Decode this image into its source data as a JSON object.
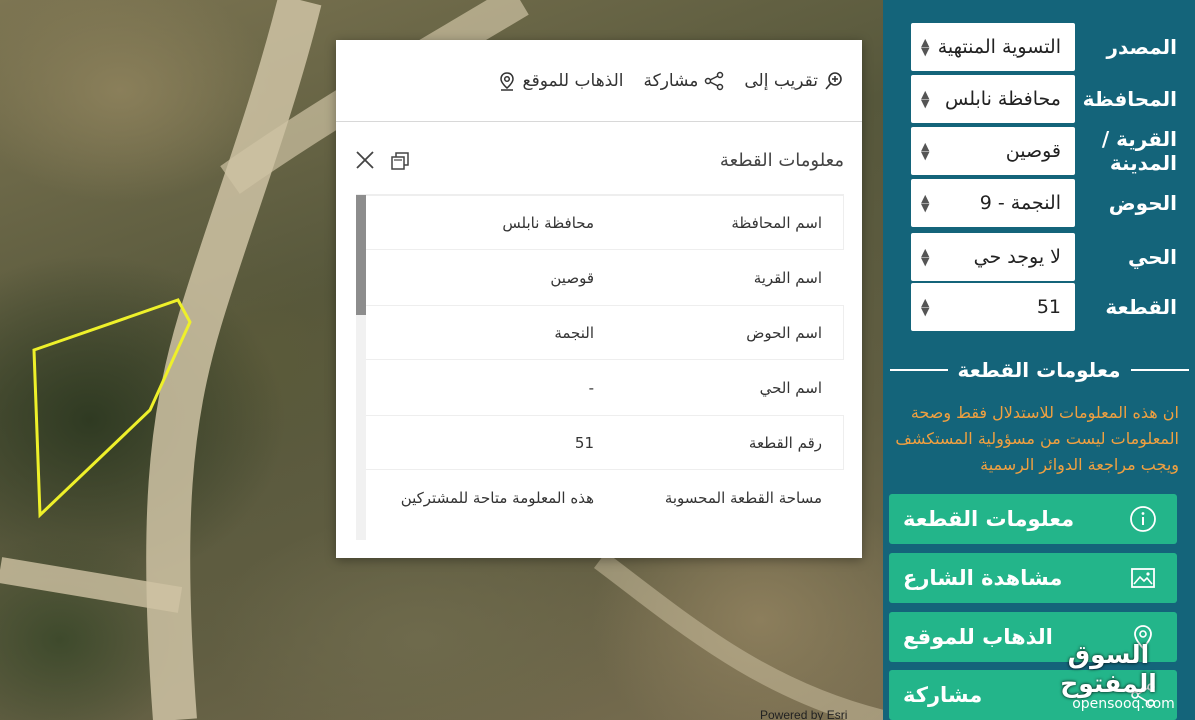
{
  "map": {
    "credit": "Powered by Esri"
  },
  "popup": {
    "actions": {
      "zoom_to": "تقريب إلى",
      "share": "مشاركة",
      "go_to_location": "الذهاب للموقع"
    },
    "title": "معلومات القطعة",
    "rows": [
      {
        "key": "اسم المحافظة",
        "value": "محافظة نابلس"
      },
      {
        "key": "اسم القرية",
        "value": "قوصين"
      },
      {
        "key": "اسم الحوض",
        "value": "النجمة"
      },
      {
        "key": "اسم الحي",
        "value": "-"
      },
      {
        "key": "رقم القطعة",
        "value": "51"
      },
      {
        "key": "مساحة القطعة المحسوبة",
        "value": "هذه المعلومة متاحة للمشتركين"
      }
    ]
  },
  "sidebar": {
    "fields": [
      {
        "label": "المصدر",
        "value": "التسوية المنتهية"
      },
      {
        "label": "المحافظة",
        "value": "محافظة نابلس"
      },
      {
        "label": "القرية / المدينة",
        "value": "قوصين"
      },
      {
        "label": "الحوض",
        "value": "النجمة - 9"
      },
      {
        "label": "الحي",
        "value": "لا يوجد حي"
      },
      {
        "label": "القطعة",
        "value": "51"
      }
    ],
    "section_title": "معلومات القطعة",
    "disclaimer": "ان هذه المعلومات للاستدلال فقط وصحة المعلومات ليست من مسؤولية المستكشف ويجب مراجعة الدوائر الرسمية",
    "buttons": {
      "parcel_info": "معلومات القطعة",
      "street_view": "مشاهدة الشارع",
      "go_to_location": "الذهاب للموقع",
      "share": "مشاركة"
    },
    "accent_color": "#23b58a",
    "sidebar_color": "#14647a",
    "disclaimer_color": "#f0a040"
  },
  "watermark": {
    "arabic": "السوق المفتوح",
    "latin": "opensooq.com"
  }
}
